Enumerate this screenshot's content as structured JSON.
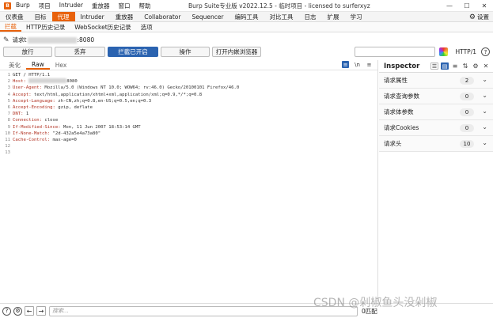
{
  "titlebar": {
    "menu": [
      "Burp",
      "项目",
      "Intruder",
      "重放器",
      "窗口",
      "帮助"
    ],
    "window_title": "Burp Suite专业版  v2022.12.5 - 临时项目 - licensed to surferxyz",
    "controls": [
      "—",
      "☐",
      "✕"
    ]
  },
  "main_tabs": [
    "仪表盘",
    "目标",
    "代理",
    "Intruder",
    "重放器",
    "Collaborator",
    "Sequencer",
    "编码工具",
    "对比工具",
    "日志",
    "扩展",
    "学习"
  ],
  "active_main_tab": "代理",
  "settings_label": "设置",
  "sub_tabs": [
    "拦截",
    "HTTP历史记录",
    "WebSocket历史记录",
    "选项"
  ],
  "request_line": {
    "prefix": "请求t",
    "suffix": ":8080"
  },
  "buttons": {
    "forward": "放行",
    "drop": "丢弃",
    "intercept": "拦截已开启",
    "action": "操作",
    "open_browser": "打开内嵌浏览器"
  },
  "http_version": "HTTP/1",
  "editor_tabs": [
    "美化",
    "Raw",
    "Hex"
  ],
  "active_editor_tab": "Raw",
  "editor_icons": [
    "≡",
    "\\n",
    "≡"
  ],
  "request_lines": [
    {
      "n": "1",
      "k": "GET / HTTP/1.1",
      "v": ""
    },
    {
      "n": "2",
      "k": "Host: ",
      "v": "8080"
    },
    {
      "n": "3",
      "k": "User-Agent: ",
      "v": "Mozilla/5.0 (Windows NT 10.0; WOW64; rv:46.0) Gecko/20100101 Firefox/46.0"
    },
    {
      "n": "4",
      "k": "Accept: ",
      "v": "text/html,application/xhtml+xml,application/xml;q=0.9,*/*;q=0.8"
    },
    {
      "n": "5",
      "k": "Accept-Language: ",
      "v": "zh-CN,zh;q=0.8,en-US;q=0.5,en;q=0.3"
    },
    {
      "n": "6",
      "k": "Accept-Encoding: ",
      "v": "gzip, deflate"
    },
    {
      "n": "7",
      "k": "DNT: ",
      "v": "1"
    },
    {
      "n": "8",
      "k": "Connection: ",
      "v": "close"
    },
    {
      "n": "9",
      "k": "If-Modified-Since: ",
      "v": "Mon, 11 Jun 2007 18:53:14 GMT"
    },
    {
      "n": "10",
      "k": "If-None-Match: ",
      "v": "\"2d-432a5e4a73a80\""
    },
    {
      "n": "11",
      "k": "Cache-Control: ",
      "v": "max-age=0"
    },
    {
      "n": "12",
      "k": "",
      "v": ""
    },
    {
      "n": "13",
      "k": "",
      "v": ""
    }
  ],
  "inspector": {
    "title": "Inspector",
    "rows": [
      {
        "label": "请求属性",
        "count": "2"
      },
      {
        "label": "请求查询参数",
        "count": "0"
      },
      {
        "label": "请求体参数",
        "count": "0"
      },
      {
        "label": "请求Cookies",
        "count": "0"
      },
      {
        "label": "请求头",
        "count": "10"
      }
    ]
  },
  "search_placeholder": "搜索...",
  "match_label": "0匹配",
  "watermark": "CSDN @剁椒鱼头没剁椒"
}
